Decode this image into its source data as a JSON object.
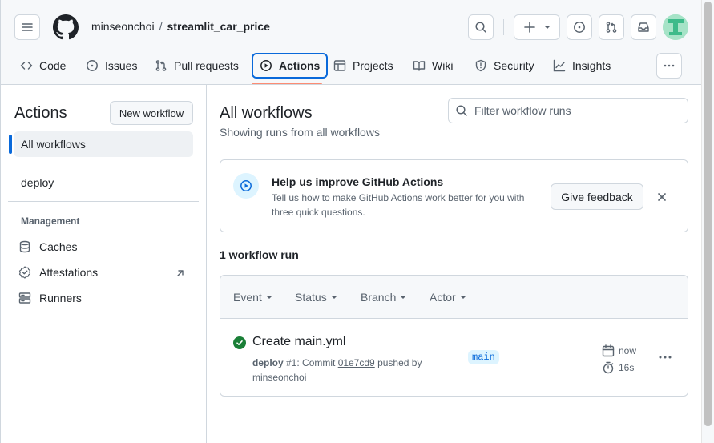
{
  "header": {
    "owner": "minseonchoi",
    "separator": "/",
    "repo": "streamlit_car_price",
    "avatar_color": "#a6e3c7"
  },
  "tabs": [
    {
      "label": "Code",
      "icon": "code-icon"
    },
    {
      "label": "Issues",
      "icon": "issue-opened-icon"
    },
    {
      "label": "Pull requests",
      "icon": "git-pull-request-icon"
    },
    {
      "label": "Actions",
      "icon": "play-icon",
      "selected": true
    },
    {
      "label": "Projects",
      "icon": "table-icon"
    },
    {
      "label": "Wiki",
      "icon": "book-icon"
    },
    {
      "label": "Security",
      "icon": "shield-icon"
    },
    {
      "label": "Insights",
      "icon": "graph-icon"
    }
  ],
  "sidebar": {
    "title": "Actions",
    "new_workflow": "New workflow",
    "items": [
      {
        "label": "All workflows",
        "active": true
      },
      {
        "label": "deploy"
      }
    ],
    "management_heading": "Management",
    "management": [
      {
        "label": "Caches",
        "icon": "database-icon"
      },
      {
        "label": "Attestations",
        "icon": "verified-icon",
        "external": true
      },
      {
        "label": "Runners",
        "icon": "server-icon"
      }
    ]
  },
  "main": {
    "title": "All workflows",
    "subtitle": "Showing runs from all workflows",
    "search_placeholder": "Filter workflow runs",
    "feedback": {
      "title": "Help us improve GitHub Actions",
      "description": "Tell us how to make GitHub Actions work better for you with three quick questions.",
      "button": "Give feedback"
    },
    "run_count": "1 workflow run",
    "filters": [
      "Event",
      "Status",
      "Branch",
      "Actor"
    ],
    "runs": [
      {
        "title": "Create main.yml",
        "workflow": "deploy",
        "meta_prefix": " #1: Commit ",
        "sha": "01e7cd9",
        "meta_suffix": " pushed by",
        "author": "minseonchoi",
        "branch": "main",
        "time": "now",
        "duration": "16s",
        "status": "success",
        "status_color": "#1a7f37"
      }
    ]
  },
  "colors": {
    "accent": "#0969da",
    "tab_underline": "#fd8c73",
    "success": "#1a7f37"
  }
}
